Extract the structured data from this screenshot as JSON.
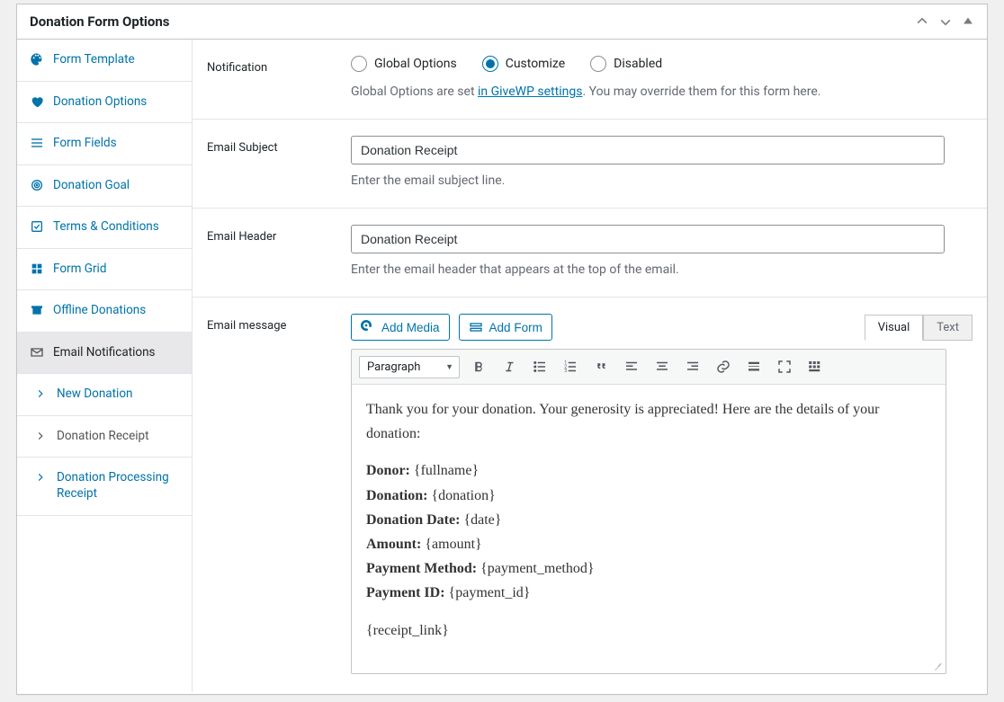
{
  "panel": {
    "title": "Donation Form Options"
  },
  "sidebar": {
    "items": [
      {
        "label": "Form Template"
      },
      {
        "label": "Donation Options"
      },
      {
        "label": "Form Fields"
      },
      {
        "label": "Donation Goal"
      },
      {
        "label": "Terms & Conditions"
      },
      {
        "label": "Form Grid"
      },
      {
        "label": "Offline Donations"
      },
      {
        "label": "Email Notifications"
      },
      {
        "label": "New Donation"
      },
      {
        "label": "Donation Receipt"
      },
      {
        "label": "Donation Processing Receipt"
      }
    ]
  },
  "notification": {
    "label": "Notification",
    "options": {
      "global": "Global Options",
      "customize": "Customize",
      "disabled": "Disabled"
    },
    "selected": "customize",
    "help_prefix": "Global Options are set ",
    "help_link": "in GiveWP settings",
    "help_suffix": ". You may override them for this form here."
  },
  "subject": {
    "label": "Email Subject",
    "value": "Donation Receipt",
    "help": "Enter the email subject line."
  },
  "header": {
    "label": "Email Header",
    "value": "Donation Receipt",
    "help": "Enter the email header that appears at the top of the email."
  },
  "message": {
    "label": "Email message",
    "add_media": "Add Media",
    "add_form": "Add Form",
    "tab_visual": "Visual",
    "tab_text": "Text",
    "format": "Paragraph",
    "intro": "Thank you for your donation. Your generosity is appreciated! Here are the details of your donation:",
    "lines": {
      "donor_k": "Donor:",
      "donor_v": " {fullname}",
      "donation_k": "Donation:",
      "donation_v": " {donation}",
      "date_k": "Donation Date:",
      "date_v": " {date}",
      "amount_k": "Amount:",
      "amount_v": " {amount}",
      "method_k": "Payment Method:",
      "method_v": " {payment_method}",
      "id_k": "Payment ID:",
      "id_v": " {payment_id}"
    },
    "receipt": "{receipt_link}"
  }
}
